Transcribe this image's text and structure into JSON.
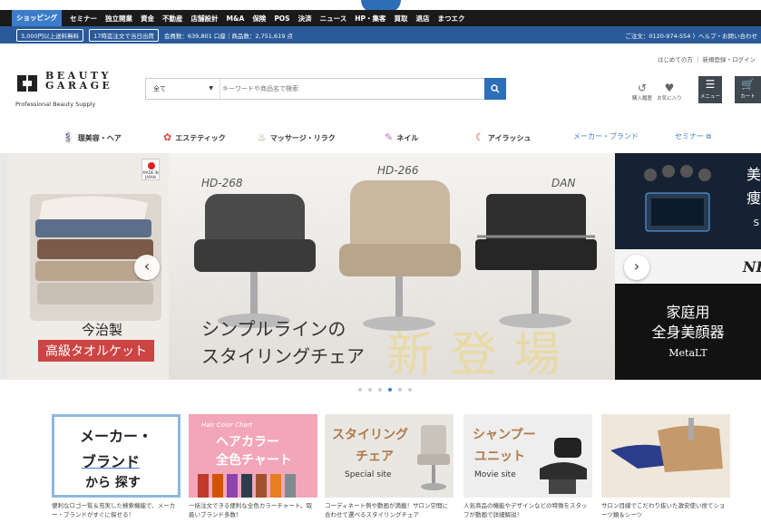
{
  "topnav": {
    "items": [
      "ショッピング",
      "セミナー",
      "独立開業",
      "資金",
      "不動産",
      "店舗設計",
      "M&A",
      "保険",
      "POS",
      "決済",
      "ニュース",
      "HP・集客",
      "買取",
      "退店",
      "まつエク"
    ]
  },
  "infobar": {
    "pill1": "3,000円以上送料無料",
    "pill2": "17時迄注文で当日出荷",
    "members": "会員数：639,801 口座｜商品数：2,751,619 点",
    "contact": "ご注文：0120-974-554 〉ヘルプ・お問い合わせ"
  },
  "header": {
    "toplinks": "はじめての方 ｜ 新規登録・ログイン",
    "logo_text": "BEAUTY GARAGE",
    "logo_sub": "Professional Beauty Supply",
    "search_category": "全て",
    "search_placeholder": "キーワードや商品名で検索",
    "icons": {
      "history": "購入履歴",
      "favorites": "お気に入り",
      "menu": "メニュー",
      "cart": "カート"
    }
  },
  "categories": [
    {
      "icon": "barber-icon",
      "glyph": "💈",
      "label": "理美容・ヘア"
    },
    {
      "icon": "esthetic-icon",
      "glyph": "✿",
      "label": "エステティック"
    },
    {
      "icon": "massage-icon",
      "glyph": "♨",
      "label": "マッサージ・リラク"
    },
    {
      "icon": "nail-icon",
      "glyph": "✎",
      "label": "ネイル"
    },
    {
      "icon": "eyelash-icon",
      "glyph": "☾",
      "label": "アイラッシュ"
    },
    {
      "label": "メーカー・ブランド"
    },
    {
      "label": "セミナー"
    }
  ],
  "carousel": {
    "left": {
      "badge": "MADE IN JAPAN",
      "caption1": "今治製",
      "caption2": "高級タオルケット"
    },
    "main": {
      "models": [
        "HD-268",
        "HD-266",
        "DAN"
      ],
      "caption1": "シンプルラインの",
      "caption2": "スタイリングチェア",
      "headline": "新登場"
    },
    "right": {
      "top1": "美",
      "top2": "痩",
      "top3": "S",
      "brand": "NI",
      "bottom1": "家庭用",
      "bottom2": "全身美顔器",
      "bottom3": "MetaLT"
    },
    "dots": 6,
    "active_dot": 3
  },
  "banners": [
    {
      "l1": "メーカー・",
      "l2": "ブランド",
      "l3": "から 探す",
      "desc": "便利なロゴ一覧＆充実した検索機能で、メーカー・ブランドがすぐに探せる！"
    },
    {
      "l0": "Hair Color Chart",
      "l1": "ヘアカラー",
      "l2": "全色チャート",
      "desc": "一括注文できる便利な全色カラーチャート。取扱いブランド多数！"
    },
    {
      "l1": "スタイリング",
      "l2": "チェア",
      "l3": "Special site",
      "desc": "コーディネート例や動画が満載！サロン空間に合わせて選べるスタイリングチェア"
    },
    {
      "l1": "シャンプー",
      "l2": "ユニット",
      "l3": "Movie site",
      "desc": "人気商品の機能やデザインなどの特徴をスタッフが動画で詳細解説！"
    },
    {
      "desc": "サロン目線でこだわり抜いた激安使い捨てショーツ類＆シーツ"
    }
  ]
}
